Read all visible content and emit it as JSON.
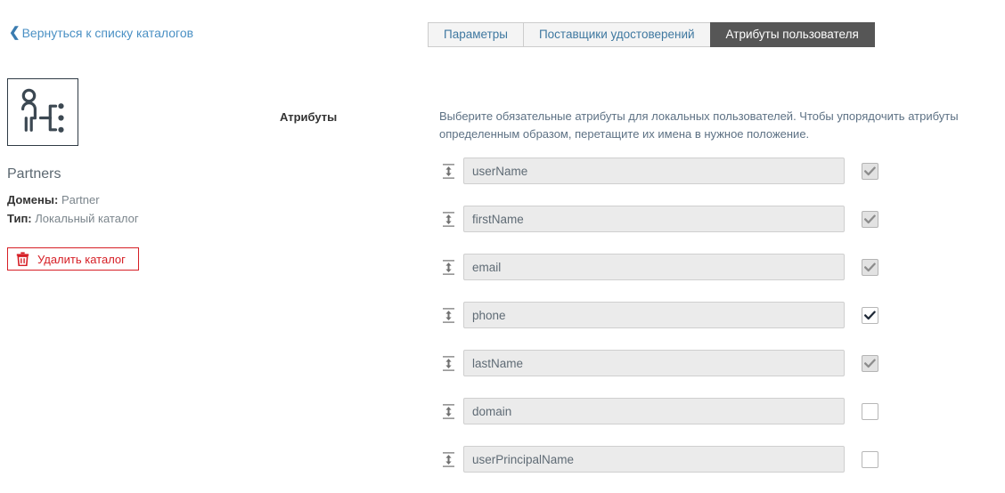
{
  "back_link": {
    "icon": "chevron-left-icon",
    "label": "Вернуться к списку каталогов"
  },
  "tabs": [
    {
      "label": "Параметры",
      "active": false
    },
    {
      "label": "Поставщики удостоверений",
      "active": false
    },
    {
      "label": "Атрибуты пользователя",
      "active": true
    }
  ],
  "directory": {
    "icon": "directory-user-tree-icon",
    "name": "Partners",
    "domains_label": "Домены:",
    "domains_value": "Partner",
    "type_label": "Тип:",
    "type_value": "Локальный каталог",
    "delete_button": {
      "icon": "trash-icon",
      "label": "Удалить каталог"
    }
  },
  "attributes_section": {
    "label": "Атрибуты",
    "description": "Выберите обязательные атрибуты для локальных пользователей. Чтобы упорядочить атрибуты определенным образом, перетащите их имена в нужное положение.",
    "rows": [
      {
        "name": "userName",
        "checked": true,
        "disabled": true
      },
      {
        "name": "firstName",
        "checked": true,
        "disabled": true
      },
      {
        "name": "email",
        "checked": true,
        "disabled": true
      },
      {
        "name": "phone",
        "checked": true,
        "disabled": false
      },
      {
        "name": "lastName",
        "checked": true,
        "disabled": true
      },
      {
        "name": "domain",
        "checked": false,
        "disabled": false
      },
      {
        "name": "userPrincipalName",
        "checked": false,
        "disabled": false
      }
    ]
  },
  "colors": {
    "link_blue": "#4a90c4",
    "active_tab_bg": "#565656",
    "danger_red": "#d61f26",
    "input_bg": "#ebebeb",
    "icon_dark": "#3c4852"
  }
}
